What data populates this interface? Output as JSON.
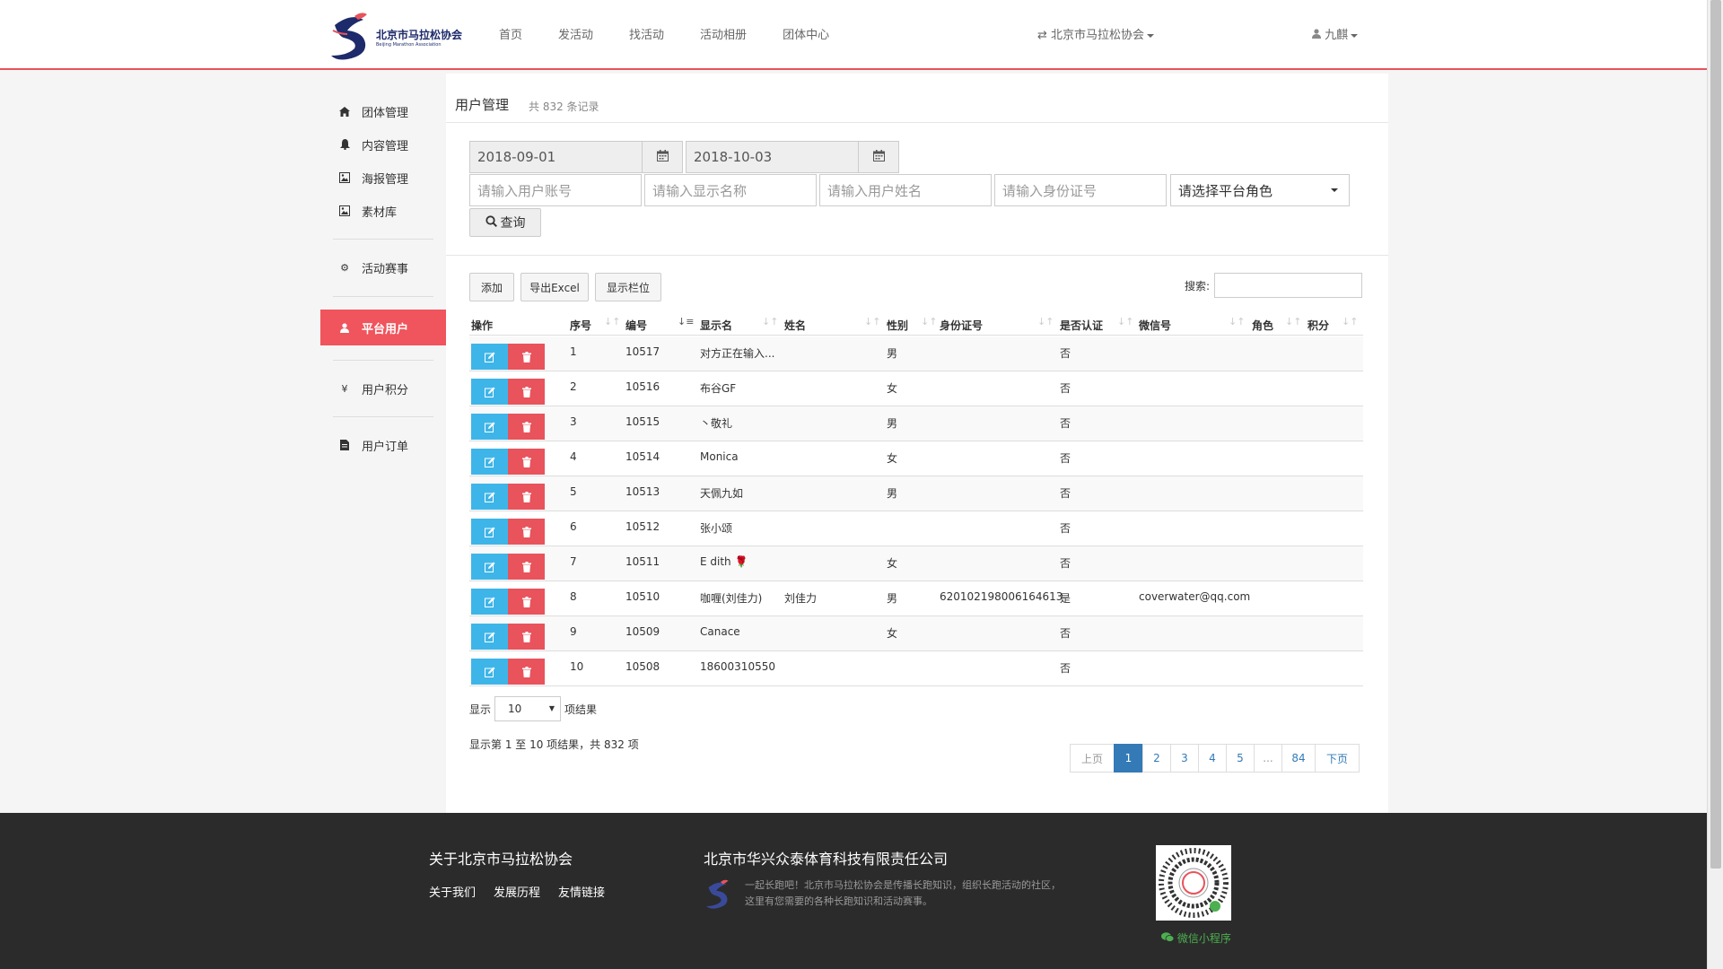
{
  "header": {
    "logo_cn": "北京市马拉松协会",
    "logo_en": "Beijing Marathon Association",
    "nav": [
      "首页",
      "发活动",
      "找活动",
      "活动相册",
      "团体中心"
    ],
    "org_switch": "北京市马拉松协会",
    "user": "九麒"
  },
  "sidebar": {
    "items": [
      {
        "label": "团体管理",
        "icon": "home-icon"
      },
      {
        "label": "内容管理",
        "icon": "bell-icon"
      },
      {
        "label": "海报管理",
        "icon": "image-icon"
      },
      {
        "label": "素材库",
        "icon": "image-icon"
      },
      {
        "label": "活动赛事",
        "icon": "gear-icon"
      },
      {
        "label": "平台用户",
        "icon": "user-icon"
      },
      {
        "label": "用户积分",
        "icon": "yen-icon"
      },
      {
        "label": "用户订单",
        "icon": "file-icon"
      }
    ],
    "active": "平台用户"
  },
  "page": {
    "title": "用户管理",
    "count": "共 832 条记录"
  },
  "filters": {
    "date_from": "2018-09-01",
    "date_to": "2018-10-03",
    "account_placeholder": "请输入用户账号",
    "display_placeholder": "请输入显示名称",
    "realname_placeholder": "请输入用户姓名",
    "idcard_placeholder": "请输入身份证号",
    "role_select": "请选择平台角色",
    "query_button": "查询"
  },
  "toolbar": {
    "add": "添加",
    "export": "导出Excel",
    "columns": "显示栏位",
    "search_label": "搜索:"
  },
  "table": {
    "columns": [
      "操作",
      "序号",
      "编号",
      "显示名",
      "姓名",
      "性别",
      "身份证号",
      "是否认证",
      "微信号",
      "角色",
      "积分"
    ],
    "rows": [
      {
        "seq": "1",
        "no": "10517",
        "display": "对方正在输入...",
        "name": "",
        "gender": "男",
        "idcard": "",
        "verified": "否",
        "wechat": ""
      },
      {
        "seq": "2",
        "no": "10516",
        "display": "布谷GF",
        "name": "",
        "gender": "女",
        "idcard": "",
        "verified": "否",
        "wechat": ""
      },
      {
        "seq": "3",
        "no": "10515",
        "display": "丶敬礼",
        "name": "",
        "gender": "男",
        "idcard": "",
        "verified": "否",
        "wechat": ""
      },
      {
        "seq": "4",
        "no": "10514",
        "display": "Monica",
        "name": "",
        "gender": "女",
        "idcard": "",
        "verified": "否",
        "wechat": ""
      },
      {
        "seq": "5",
        "no": "10513",
        "display": "天佩九如",
        "name": "",
        "gender": "男",
        "idcard": "",
        "verified": "否",
        "wechat": ""
      },
      {
        "seq": "6",
        "no": "10512",
        "display": "张小颂",
        "name": "",
        "gender": "",
        "idcard": "",
        "verified": "否",
        "wechat": ""
      },
      {
        "seq": "7",
        "no": "10511",
        "display": "E dith 🌹",
        "name": "",
        "gender": "女",
        "idcard": "",
        "verified": "否",
        "wechat": ""
      },
      {
        "seq": "8",
        "no": "10510",
        "display": "咖喱(刘佳力)",
        "name": "刘佳力",
        "gender": "男",
        "idcard": "620102198006164613",
        "verified": "是",
        "wechat": "coverwater@qq.com"
      },
      {
        "seq": "9",
        "no": "10509",
        "display": "Canace",
        "name": "",
        "gender": "女",
        "idcard": "",
        "verified": "否",
        "wechat": ""
      },
      {
        "seq": "10",
        "no": "10508",
        "display": "18600310550",
        "name": "",
        "gender": "",
        "idcard": "",
        "verified": "否",
        "wechat": ""
      }
    ]
  },
  "paging": {
    "show_label": "显示",
    "page_size": "10",
    "result_label": "项结果",
    "info": "显示第 1 至 10 项结果，共 832 项",
    "prev": "上页",
    "pages": [
      "1",
      "2",
      "3",
      "4",
      "5",
      "...",
      "84"
    ],
    "next": "下页",
    "current": "1"
  },
  "footer": {
    "about_title": "关于北京市马拉松协会",
    "links": [
      "关于我们",
      "发展历程",
      "友情链接"
    ],
    "company": "北京市华兴众泰体育科技有限责任公司",
    "desc": "一起长跑吧！北京市马拉松协会是传播长跑知识，组织长跑活动的社区，这里有您需要的各种长跑知识和活动赛事。",
    "mini_program": "微信小程序"
  },
  "colors": {
    "accent": "#f0545c",
    "edit": "#3eb5e8",
    "delete": "#e8535c",
    "link": "#337ab7"
  }
}
